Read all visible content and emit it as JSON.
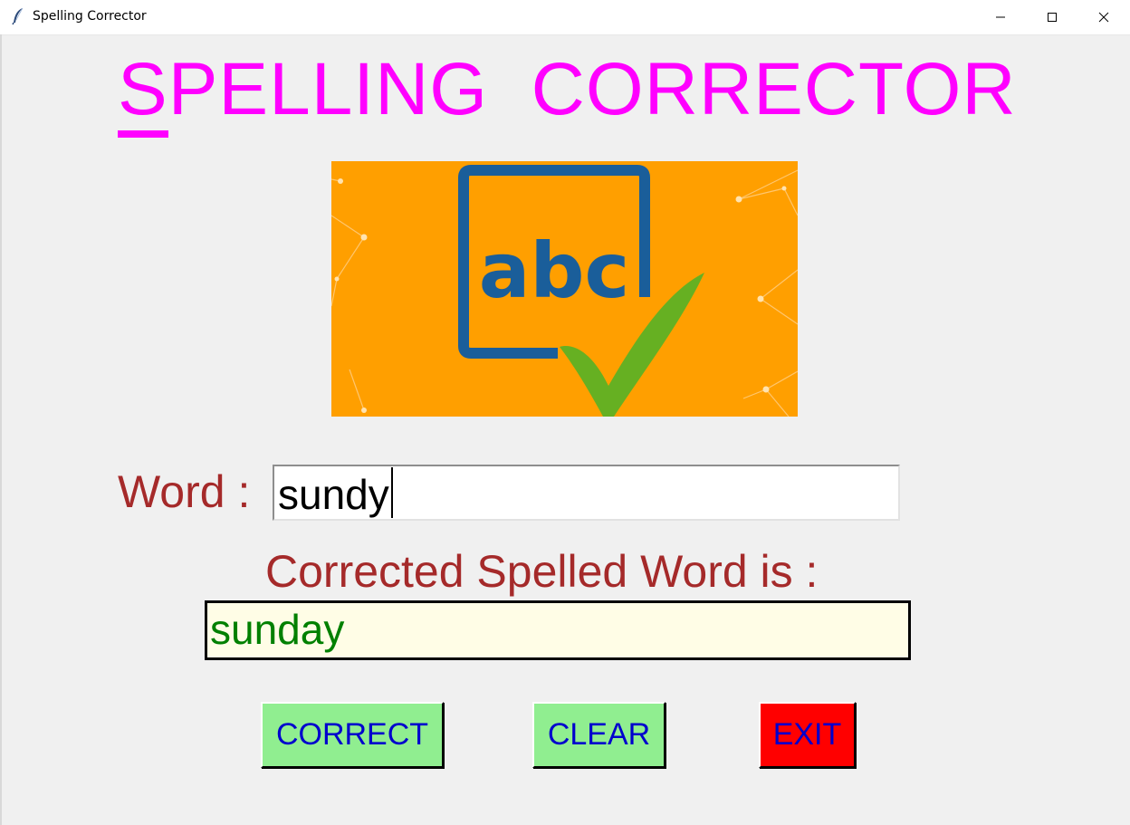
{
  "window": {
    "title": "Spelling Corrector",
    "controls": [
      "minimize",
      "maximize",
      "close"
    ]
  },
  "heading": {
    "first_letter": "S",
    "rest": "PELLING  CORRECTOR",
    "color": "#ff00ff"
  },
  "logo": {
    "text": "abc",
    "background": "#ff9f00",
    "frame_color": "#1a5e9a",
    "check_color": "#66b022"
  },
  "form": {
    "word_label": "Word : ",
    "word_value": "sundy",
    "corrected_label": "Corrected Spelled Word is :",
    "corrected_value": "sunday",
    "label_color": "#a52a2a",
    "result_color": "#008000"
  },
  "buttons": {
    "correct": "CORRECT",
    "clear": "CLEAR",
    "exit": "EXIT"
  }
}
